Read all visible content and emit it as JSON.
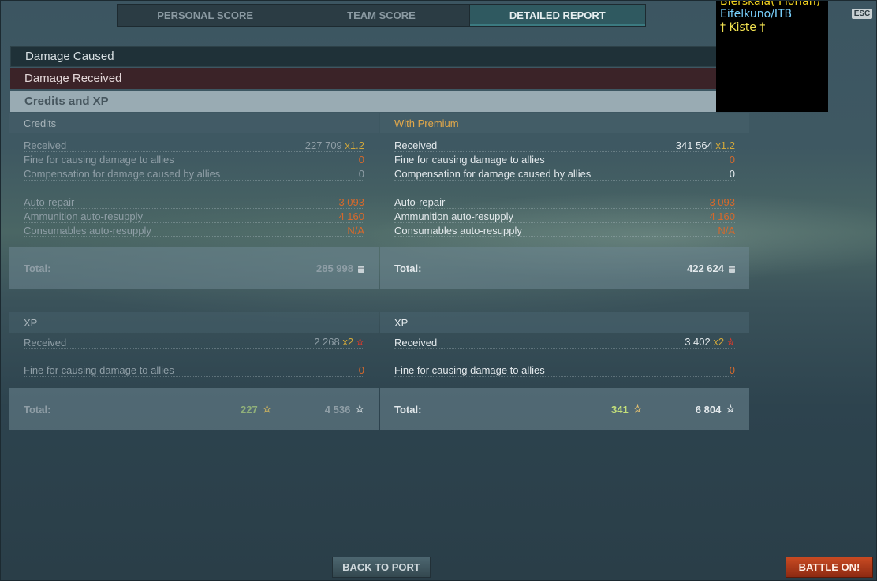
{
  "tabs": [
    {
      "label": "PERSONAL SCORE"
    },
    {
      "label": "TEAM SCORE"
    },
    {
      "label": "DETAILED REPORT"
    }
  ],
  "sections": {
    "damage_caused": "Damage Caused",
    "damage_received": "Damage Received",
    "credits_xp": "Credits and XP"
  },
  "credits": {
    "base": {
      "header": "Credits",
      "received_label": "Received",
      "received_value": "227 709",
      "received_mult": "x1.2",
      "fine_label": "Fine for causing damage to allies",
      "fine_value": "0",
      "comp_label": "Compensation for damage caused by allies",
      "comp_value": "0",
      "repair_label": "Auto-repair",
      "repair_value": "3 093",
      "ammo_label": "Ammunition auto-resupply",
      "ammo_value": "4 160",
      "cons_label": "Consumables auto-resupply",
      "cons_value": "N/A",
      "total_label": "Total:",
      "total_value": "285 998"
    },
    "premium": {
      "header": "With Premium",
      "received_label": "Received",
      "received_value": "341 564",
      "received_mult": "x1.2",
      "fine_label": "Fine for causing damage to allies",
      "fine_value": "0",
      "comp_label": "Compensation for damage caused by allies",
      "comp_value": "0",
      "repair_label": "Auto-repair",
      "repair_value": "3 093",
      "ammo_label": "Ammunition auto-resupply",
      "ammo_value": "4 160",
      "cons_label": "Consumables auto-resupply",
      "cons_value": "N/A",
      "total_label": "Total:",
      "total_value": "422 624"
    }
  },
  "xp": {
    "base": {
      "header": "XP",
      "received_label": "Received",
      "received_value": "2 268",
      "received_mult": "x2",
      "fine_label": "Fine for causing damage to allies",
      "fine_value": "0",
      "total_label": "Total:",
      "total_xp": "227",
      "total_free": "4 536"
    },
    "premium": {
      "header": "XP",
      "received_label": "Received",
      "received_value": "3 402",
      "received_mult": "x2",
      "fine_label": "Fine for causing damage to allies",
      "fine_value": "0",
      "total_label": "Total:",
      "total_xp": "341",
      "total_free": "6 804"
    }
  },
  "overlay": {
    "lines": [
      "Bierskala( Florian)",
      "Eifelkuno/ITB",
      "† Kiste †"
    ],
    "colors": [
      "#f0d020",
      "#7ad2ff",
      "#f0e050"
    ]
  },
  "esc_label": "ESC",
  "buttons": {
    "back_to_port": "BACK TO PORT",
    "battle_on": "BATTLE ON!"
  },
  "colors": {
    "accent_premium": "#e2a84a",
    "negative": "#d7692b",
    "xp_green_base": "#90b07a",
    "xp_green_premium": "#c4e07a"
  }
}
